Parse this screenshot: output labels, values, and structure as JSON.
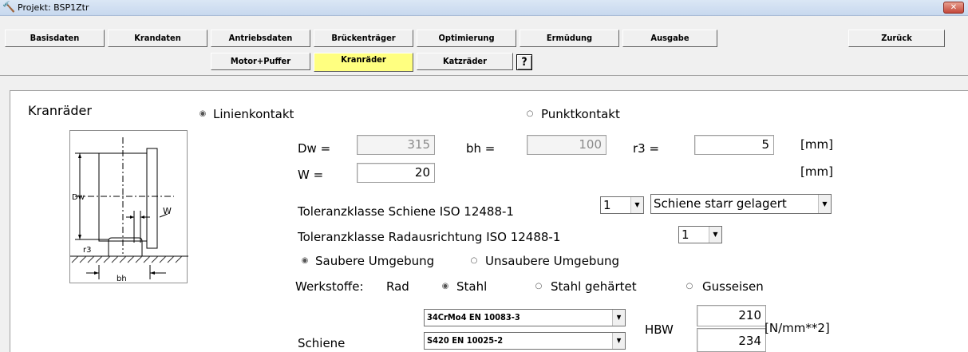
{
  "window": {
    "title": "Projekt: BSP1Ztr",
    "close_label": "✕"
  },
  "tabs_row1": [
    "Basisdaten",
    "Krandaten",
    "Antriebsdaten",
    "Brückenträger",
    "Optimierung",
    "Ermüdung",
    "Ausgabe"
  ],
  "back_label": "Zurück",
  "tabs_row2": [
    "Motor+Puffer",
    "Kranräder",
    "Katzräder"
  ],
  "help_label": "?",
  "section_title": "Kranräder",
  "contact": {
    "linien": "Linienkontakt",
    "punkt": "Punktkontakt",
    "selected": "Linienkontakt"
  },
  "dims": {
    "dw_label": "Dw =",
    "dw_value": "315",
    "bh_label": "bh =",
    "bh_value": "100",
    "r3_label": "r3 =",
    "r3_value": "5",
    "unit1": "[mm]",
    "w_label": "W =",
    "w_value": "20",
    "unit2": "[mm]"
  },
  "tolerance_rail": {
    "label": "Toleranzklasse Schiene ISO 12488-1",
    "value": "1",
    "mount": "Schiene starr gelagert"
  },
  "tolerance_wheel": {
    "label": "Toleranzklasse Radausrichtung ISO 12488-1",
    "value": "1"
  },
  "environment": {
    "clean": "Saubere Umgebung",
    "dirty": "Unsaubere Umgebung",
    "selected": "Saubere Umgebung"
  },
  "materials": {
    "label": "Werkstoffe:",
    "rad_label": "Rad",
    "options": [
      "Stahl",
      "Stahl gehärtet",
      "Gusseisen"
    ],
    "selected": "Stahl",
    "wheel_material": "34CrMo4 EN 10083-3",
    "rail_label": "Schiene",
    "rail_material": "S420 EN 10025-2",
    "hbw_label": "HBW",
    "hbw_wheel": "210",
    "hbw_rail": "234",
    "hbw_unit": "[N/mm**2]"
  },
  "sketch_labels": {
    "dw": "Dw",
    "w": "W",
    "r3": "r3",
    "bh": "bh"
  }
}
